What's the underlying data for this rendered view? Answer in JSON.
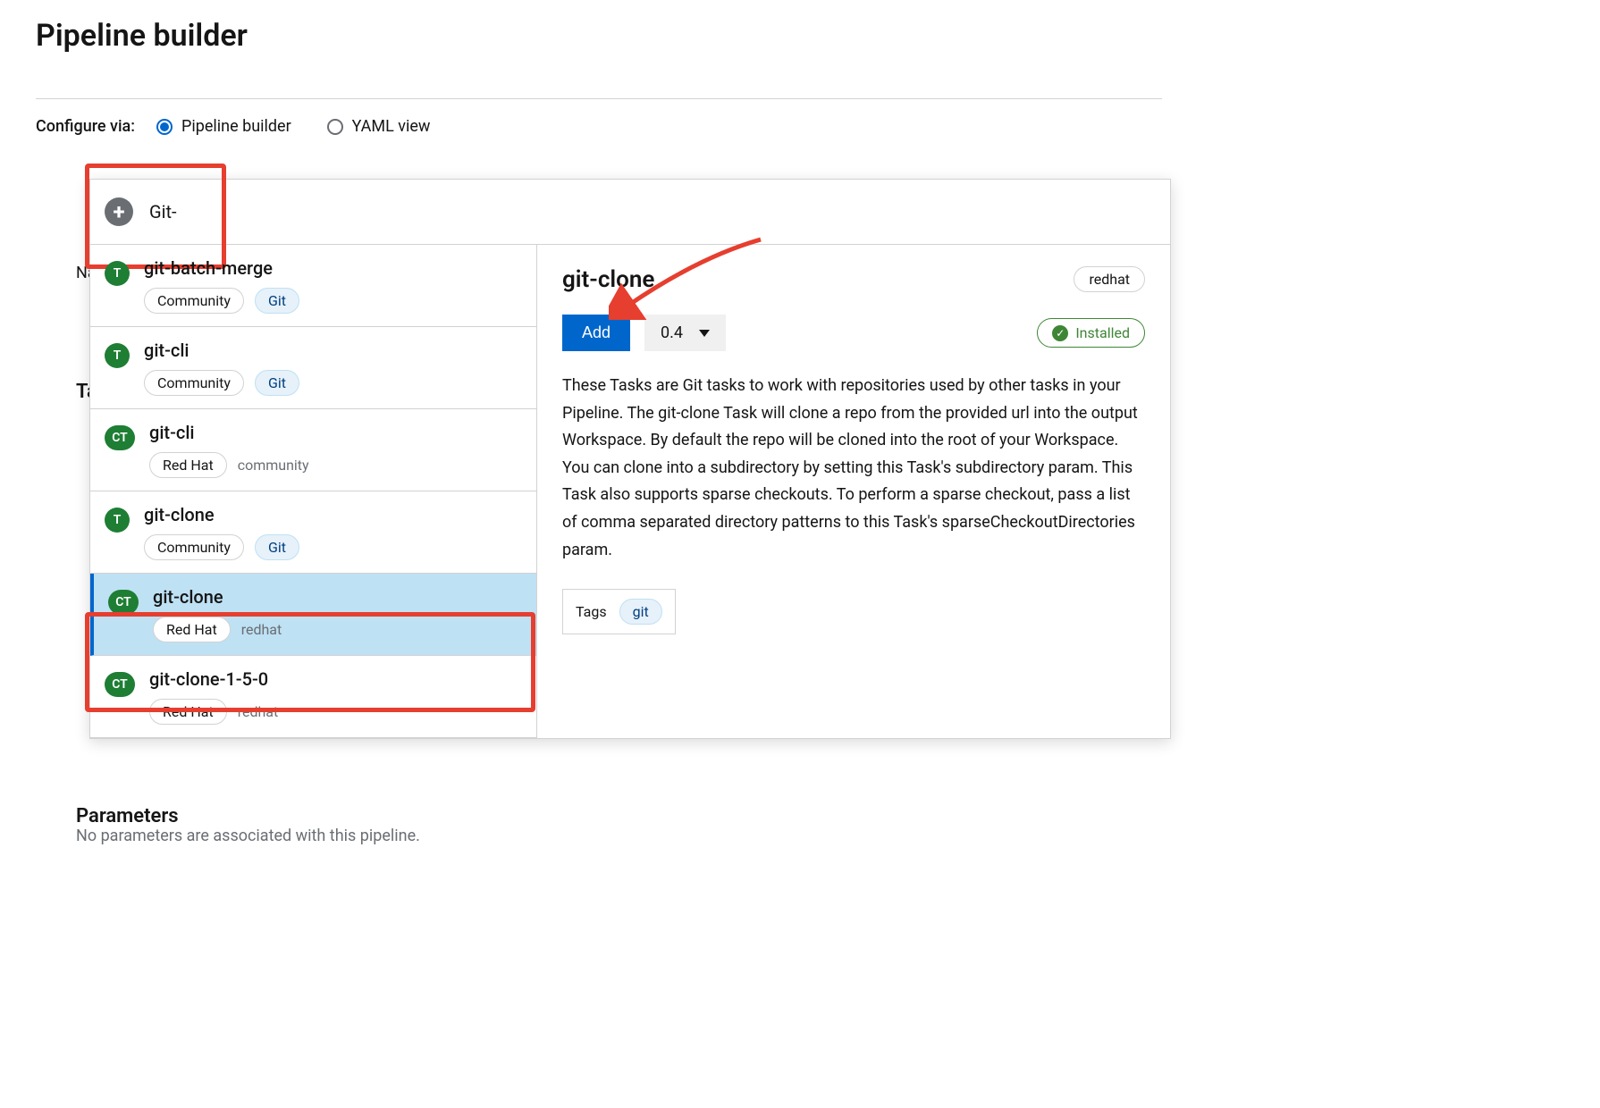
{
  "page_title": "Pipeline builder",
  "configure": {
    "label": "Configure via:",
    "options": [
      "Pipeline builder",
      "YAML view"
    ],
    "selected_index": 0
  },
  "background": {
    "name_label": "Name",
    "tasks_label": "Tasks",
    "params_label": "Parameters",
    "no_params_text": "No parameters are associated with this pipeline."
  },
  "search": {
    "value": "Git-"
  },
  "tasks": [
    {
      "name": "git-batch-merge",
      "badge": "T",
      "pill": "Community",
      "tag": "Git",
      "provider": ""
    },
    {
      "name": "git-cli",
      "badge": "T",
      "pill": "Community",
      "tag": "Git",
      "provider": ""
    },
    {
      "name": "git-cli",
      "badge": "CT",
      "pill": "Red Hat",
      "tag": "",
      "provider": "community"
    },
    {
      "name": "git-clone",
      "badge": "T",
      "pill": "Community",
      "tag": "Git",
      "provider": ""
    },
    {
      "name": "git-clone",
      "badge": "CT",
      "pill": "Red Hat",
      "tag": "",
      "provider": "redhat",
      "selected": true
    },
    {
      "name": "git-clone-1-5-0",
      "badge": "CT",
      "pill": "Red Hat",
      "tag": "",
      "provider": "redhat"
    }
  ],
  "details": {
    "title": "git-clone",
    "provider_pill": "redhat",
    "add_button": "Add",
    "version": "0.4",
    "installed_label": "Installed",
    "description": "These Tasks are Git tasks to work with repositories used by other tasks in your Pipeline. The git-clone Task will clone a repo from the provided url into the output Workspace. By default the repo will be cloned into the root of your Workspace. You can clone into a subdirectory by setting this Task's subdirectory param. This Task also supports sparse checkouts. To perform a sparse checkout, pass a list of comma separated directory patterns to this Task's sparseCheckoutDirectories param.",
    "tags_label": "Tags",
    "tags": [
      "git"
    ]
  }
}
